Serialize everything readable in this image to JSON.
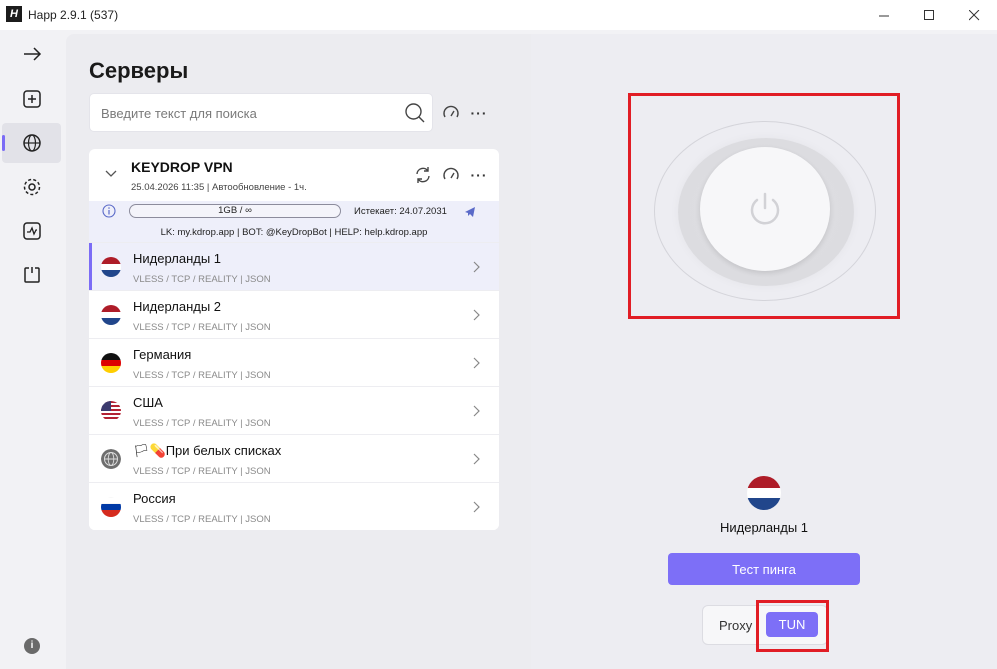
{
  "window": {
    "logo": "H",
    "title": "Happ 2.9.1 (537)",
    "minimize": "—",
    "maximize": "☐",
    "close": "✕"
  },
  "sidebar": {
    "items": [
      {
        "icon": "arrow-right-icon"
      },
      {
        "icon": "plus-square-icon"
      },
      {
        "icon": "globe-icon",
        "active": true
      },
      {
        "icon": "gear-icon"
      },
      {
        "icon": "chart-icon"
      },
      {
        "icon": "power-square-icon"
      }
    ],
    "info": "i"
  },
  "servers": {
    "title": "Серверы",
    "search_placeholder": "Введите текст для поиска",
    "more": "···"
  },
  "subscription": {
    "name": "KEYDROP VPN",
    "meta": "25.04.2026 11:35 | Автообновление - 1ч.",
    "traffic": "1GB / ∞",
    "expires": "Истекает: 24.07.2031",
    "links": "LK: my.kdrop.app | BOT: @KeyDropBot | HELP: help.kdrop.app",
    "more": "···"
  },
  "server_list": [
    {
      "name": "Нидерланды 1",
      "proto": "VLESS / TCP / REALITY | JSON",
      "flag": "nl",
      "selected": true
    },
    {
      "name": "Нидерланды 2",
      "proto": "VLESS / TCP / REALITY | JSON",
      "flag": "nl"
    },
    {
      "name": "Германия",
      "proto": "VLESS / TCP / REALITY | JSON",
      "flag": "de"
    },
    {
      "name": "США",
      "proto": "VLESS / TCP / REALITY | JSON",
      "flag": "us"
    },
    {
      "name": "🏳💊При белых списках",
      "proto": "VLESS / TCP / REALITY | JSON",
      "flag": "globe"
    },
    {
      "name": "Россия",
      "proto": "VLESS / TCP / REALITY | JSON",
      "flag": "ru"
    }
  ],
  "connection": {
    "current_server": "Нидерланды 1",
    "ping_button": "Тест пинга",
    "mode_proxy": "Proxy",
    "mode_tun": "TUN",
    "selected_mode": "TUN"
  },
  "colors": {
    "accent": "#7d6ff7",
    "highlight": "#e11d25"
  }
}
